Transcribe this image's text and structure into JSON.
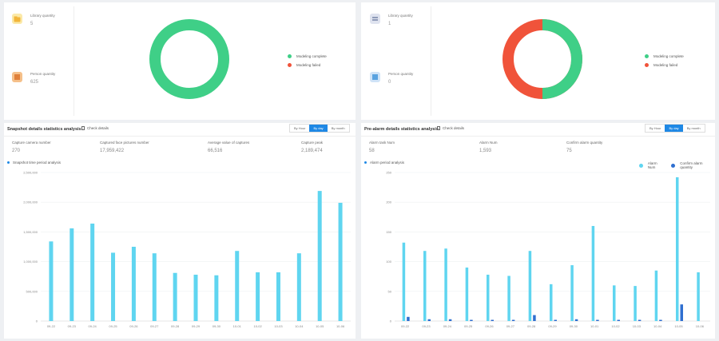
{
  "left_top": {
    "library": {
      "label": "Library quantity",
      "value": "5"
    },
    "person": {
      "label": "Person quantity",
      "value": "625"
    },
    "legend": [
      "Modeling complete",
      "Modeling failed"
    ],
    "donut": {
      "complete": 1.0,
      "failed": 0.0
    }
  },
  "right_top": {
    "library": {
      "label": "Library quantity",
      "value": "1"
    },
    "person": {
      "label": "Person quantity",
      "value": "0"
    },
    "legend": [
      "Modeling complete",
      "Modeling failed"
    ],
    "donut": {
      "complete": 0.5,
      "failed": 0.5
    }
  },
  "snapshot": {
    "title": "Snapshot details statistics analysis",
    "check": "Check details",
    "tabs": [
      "By Hour",
      "By day",
      "By month"
    ],
    "active_tab": "By day",
    "kpis": [
      {
        "label": "Capture camera number",
        "value": "270"
      },
      {
        "label": "Captured face pictures number",
        "value": "17,959,422"
      },
      {
        "label": "Average value of captures",
        "value": "66,516"
      },
      {
        "label": "Capture peak",
        "value": "2,189,474"
      }
    ],
    "series_title": "Snapshot time period analysis"
  },
  "prealarm": {
    "title": "Pre-alarm details statistics analysis",
    "check": "Check details",
    "tabs": [
      "By Hour",
      "By day",
      "By month"
    ],
    "active_tab": "By day",
    "kpis": [
      {
        "label": "Alarm task Num",
        "value": "58"
      },
      {
        "label": "Alarm Num",
        "value": "1,593"
      },
      {
        "label": "Confirm alarm quantity",
        "value": "75"
      }
    ],
    "series_title": "Alarm period analysis",
    "legend": [
      "Alarm Num",
      "Confirm alarm quantity"
    ]
  },
  "chart_data": [
    {
      "type": "bar",
      "categories": [
        "09-22",
        "09-23",
        "09-24",
        "09-25",
        "09-26",
        "09-27",
        "09-28",
        "09-29",
        "09-30",
        "10-01",
        "10-02",
        "10-03",
        "10-04",
        "10-05",
        "10-06"
      ],
      "series": [
        {
          "values": [
            1340000,
            1560000,
            1640000,
            1150000,
            1250000,
            1140000,
            810000,
            780000,
            770000,
            1180000,
            820000,
            820000,
            1140000,
            2189474,
            1990000
          ]
        }
      ],
      "yticks": [
        "0",
        "500,000",
        "1,000,000",
        "1,500,000",
        "2,000,000",
        "2,500,000"
      ],
      "ylim": [
        0,
        2500000
      ],
      "color": "#5fd5f0"
    },
    {
      "type": "bar",
      "categories": [
        "09-22",
        "09-23",
        "09-24",
        "09-25",
        "09-26",
        "09-27",
        "09-28",
        "09-29",
        "09-30",
        "10-01",
        "10-02",
        "10-03",
        "10-04",
        "10-05",
        "10-06"
      ],
      "series": [
        {
          "name": "Alarm Num",
          "values": [
            132,
            118,
            122,
            90,
            78,
            76,
            118,
            62,
            94,
            160,
            60,
            59,
            85,
            242,
            82
          ]
        },
        {
          "name": "Confirm alarm quantity",
          "values": [
            7,
            3,
            3,
            2,
            2,
            2,
            10,
            2,
            3,
            2,
            2,
            2,
            2,
            28,
            0
          ]
        }
      ],
      "yticks": [
        "0",
        "50",
        "100",
        "150",
        "200",
        "250"
      ],
      "ylim": [
        0,
        250
      ],
      "colors": [
        "#5fd5f0",
        "#2f6fd0"
      ]
    }
  ],
  "colors": {
    "complete": "#3fcf87",
    "failed": "#f0533a",
    "accent": "#1e88e5"
  }
}
